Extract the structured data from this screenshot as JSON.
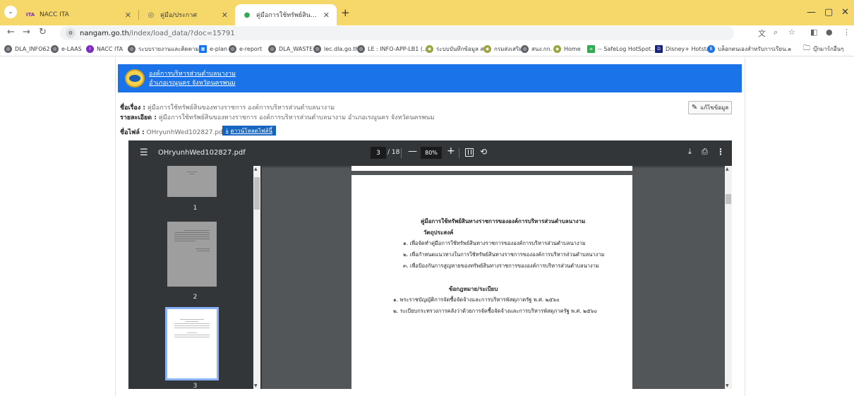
{
  "browser": {
    "tabs": [
      {
        "label": "NACC ITA",
        "favicon": "nacc-logo-icon",
        "active": false
      },
      {
        "label": "คู่มือ/ประกาศ",
        "favicon": "globe-icon",
        "active": false
      },
      {
        "label": "คู่มือการใช้ทรัพย์สินของทางราชการ ::",
        "favicon": "org-favicon-icon",
        "active": true
      }
    ],
    "url_host": "nangam.go.th",
    "url_path": "/index/load_data/?doc=15791",
    "bookmarks": [
      {
        "label": "DLA_INFO62",
        "color": "#5f6368"
      },
      {
        "label": "e-LAAS",
        "color": "#5f6368"
      },
      {
        "label": "NACC ITA",
        "color": "#7b2cbf"
      },
      {
        "label": "ระบบรายงานและติดตาม...",
        "color": "#5f6368"
      },
      {
        "label": "e-plan",
        "color": "#1a73e8"
      },
      {
        "label": "e-report",
        "color": "#5f6368"
      },
      {
        "label": "DLA_WASTE",
        "color": "#5f6368"
      },
      {
        "label": "lec.dla.go.th",
        "color": "#5f6368"
      },
      {
        "label": "LE : INFO-APP-LB1 (...",
        "color": "#5f6368"
      },
      {
        "label": "ระบบบันทึกข้อมูล สถ.",
        "color": "#9aa33c"
      },
      {
        "label": "กรมส่งเสริม",
        "color": "#9aa33c"
      },
      {
        "label": "สนง.กก.",
        "color": "#5f6368"
      },
      {
        "label": "Home",
        "color": "#9aa33c"
      },
      {
        "label": "-- SafeLog HotSpot...",
        "color": "#34a853"
      },
      {
        "label": "Disney+ Hotstar",
        "color": "#1a237e"
      },
      {
        "label": "บล็อกตนเองสำหรับการเรียน...",
        "color": "#1a73e8"
      }
    ],
    "bookmarks_overflow": "»",
    "other_bookmarks": "บุ๊กมาร์กอื่นๆ"
  },
  "site": {
    "org_name_line1": "องค์การบริหารส่วนตำบลนางาม",
    "org_name_line2": "อำเภอเรณูนคร จังหวัดนครพนม",
    "subject_label": "ชื่อเรื่อง :",
    "subject_value": "คู่มือการใช้ทรัพย์สินของทางราชการ องค์การบริหารส่วนตำบลนางาม",
    "detail_label": "รายละเอียด :",
    "detail_value": "คู่มือการใช้ทรัพย์สินของทางราชการ องค์การบริหารส่วนตำบลนางาม อำเภอเรณูนคร จังหวัดนครพนม",
    "filename_label": "ชื่อไฟล์ :",
    "filename_value": "OHryunhWed102827.pdf",
    "download_label": "ดาวน์โหลดไฟล์นี้",
    "edit_label": "แก้ไขข้อมูล"
  },
  "viewer": {
    "filename": "OHryunhWed102827.pdf",
    "current_page": "3",
    "total_pages": "/ 18",
    "zoom": "80%",
    "thumbnails": [
      {
        "number": "1"
      },
      {
        "number": "2"
      },
      {
        "number": "3"
      }
    ]
  },
  "document": {
    "title": "คู่มือการใช้ทรัพย์สินทางราชการขององค์การบริหารส่วนตำบลนางาม",
    "objective_heading": "วัตถุประสงค์",
    "objectives": [
      "๑. เพื่อจัดทำคู่มือการใช้ทรัพย์สินทางราชการขององค์การบริหารส่วนตำบลนางาม",
      "๒. เพื่อกำหนดแนวทางในการใช้ทรัพย์สินทางราชการขององค์การบริหารส่วนตำบลนางาม",
      "๓. เพื่อป้องกันการสูญหายของทรัพย์สินทางราชการขององค์การบริหารส่วนตำบลนางาม"
    ],
    "law_heading": "ข้อกฎหมาย/ระเบียบ",
    "laws": [
      "๑. พระราชบัญญัติการจัดซื้อจัดจ้างและการบริหารพัสดุภาครัฐ พ.ศ. ๒๕๖๐",
      "๒. ระเบียบกระทรวงการคลังว่าด้วยการจัดซื้อจัดจ้างและการบริหารพัสดุภาครัฐ พ.ศ. ๒๕๖๐"
    ]
  }
}
